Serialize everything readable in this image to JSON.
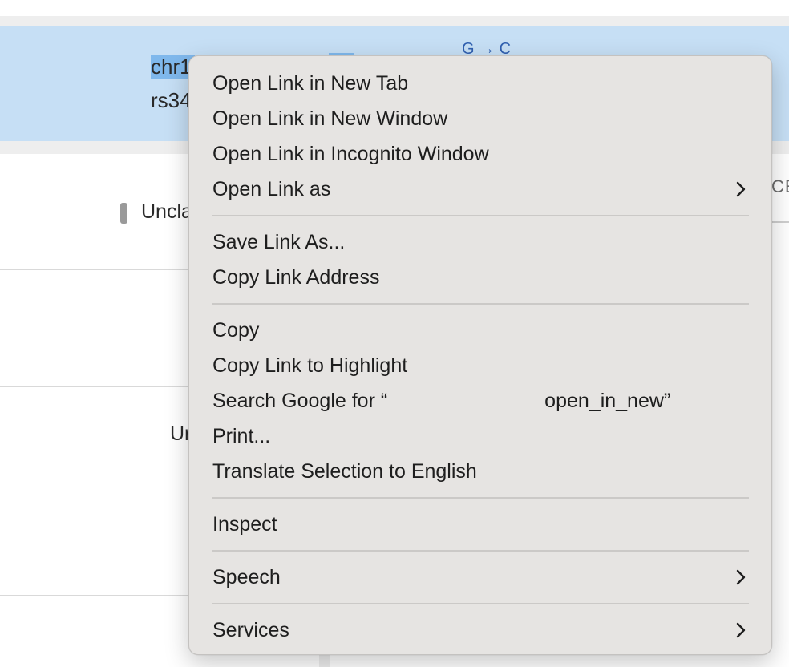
{
  "background": {
    "variant_id_visible": "chr1",
    "rsid_visible": "rs34",
    "allele_change": "G → C",
    "clinical_label_1": "Uncla",
    "clinical_label_2": "Ur",
    "column_header_fragment": "CE"
  },
  "context_menu": {
    "groups": [
      {
        "items": [
          {
            "label": "Open Link in New Tab",
            "submenu": false
          },
          {
            "label": "Open Link in New Window",
            "submenu": false
          },
          {
            "label": "Open Link in Incognito Window",
            "submenu": false
          },
          {
            "label": "Open Link as",
            "submenu": true
          }
        ]
      },
      {
        "items": [
          {
            "label": "Save Link As...",
            "submenu": false
          },
          {
            "label": "Copy Link Address",
            "submenu": false
          }
        ]
      },
      {
        "items": [
          {
            "label": "Copy",
            "submenu": false
          },
          {
            "label": "Copy Link to Highlight",
            "submenu": false
          },
          {
            "label": "Search Google for “",
            "submenu": false,
            "suffix": "open_in_new”"
          },
          {
            "label": "Print...",
            "submenu": false
          },
          {
            "label": "Translate Selection to English",
            "submenu": false
          }
        ]
      },
      {
        "items": [
          {
            "label": "Inspect",
            "submenu": false
          }
        ]
      },
      {
        "items": [
          {
            "label": "Speech",
            "submenu": true
          }
        ]
      },
      {
        "items": [
          {
            "label": "Services",
            "submenu": true
          }
        ]
      }
    ]
  },
  "icons": {
    "submenu": "chevron-right-icon"
  },
  "colors": {
    "selection_row": "#c6dff5",
    "text_selection": "#7fb8ec",
    "menu_background": "#e6e4e2",
    "allele_text": "#2f5fb0"
  }
}
